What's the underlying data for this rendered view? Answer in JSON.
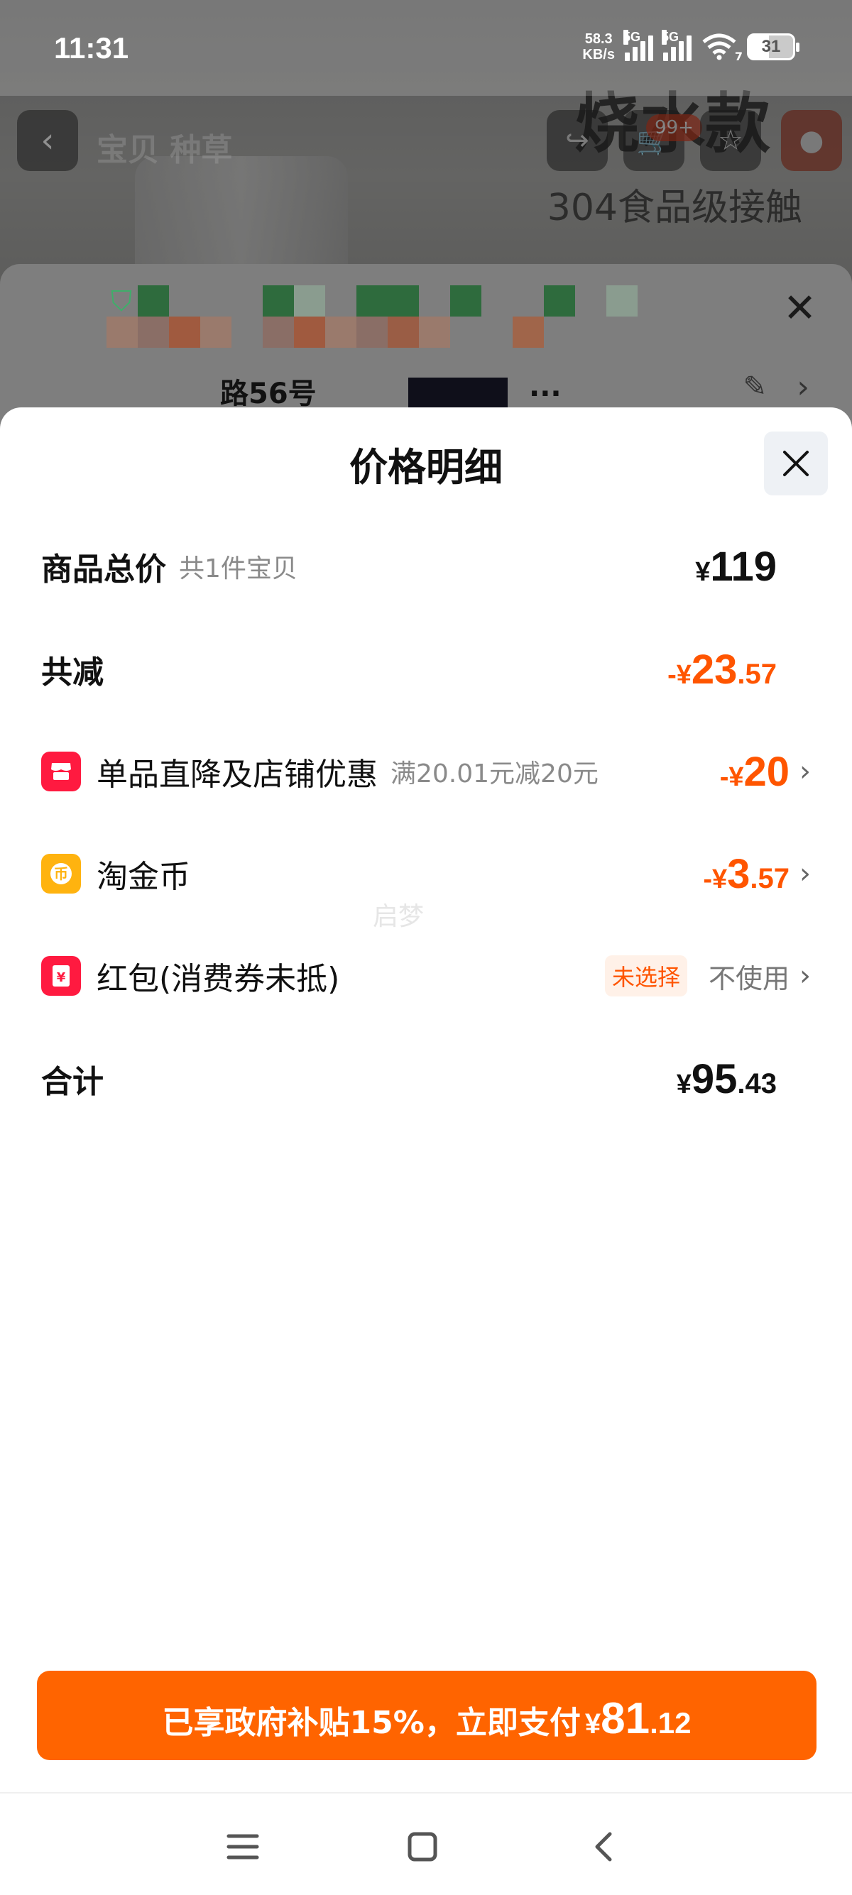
{
  "status_bar": {
    "time": "11:31",
    "net_speed_value": "58.3",
    "net_speed_unit": "KB/s",
    "signal_1_tag": "5G",
    "signal_2_tag": "5G",
    "wifi_tag": "7",
    "battery": "31"
  },
  "background_page": {
    "tabs": "宝贝  种草",
    "cart_badge": "99+",
    "promo_title": "烧水款",
    "promo_subtitle": "304食品级接触",
    "address_fragment": "路56号",
    "address_fragment_2": "..."
  },
  "modal": {
    "title": "价格明细",
    "rows": {
      "subtotal": {
        "label": "商品总价",
        "sub": "共1件宝贝",
        "currency": "¥",
        "int": "119",
        "dec": ""
      },
      "total_discount": {
        "label": "共减",
        "prefix": "-",
        "currency": "¥",
        "int": "23",
        "dec": ".57"
      },
      "shop_discount": {
        "label": "单品直降及店铺优惠",
        "sub": "满20.01元减20元",
        "prefix": "-",
        "currency": "¥",
        "int": "20",
        "dec": ""
      },
      "coins": {
        "label": "淘金币",
        "prefix": "-",
        "currency": "¥",
        "int": "3",
        "dec": ".57"
      },
      "red_packet": {
        "label": "红包(消费券未抵)",
        "tag": "未选择",
        "value": "不使用"
      },
      "total": {
        "label": "合计",
        "currency": "¥",
        "int": "95",
        "dec": ".43"
      }
    },
    "watermark": "启梦"
  },
  "pay_button": {
    "text": "已享政府补贴15%，立即支付",
    "currency": "¥",
    "int": "81",
    "dec": ".12"
  },
  "colors": {
    "accent_orange": "#ff5500",
    "pay_button": "#ff6400",
    "icon_red": "#ff1a40",
    "icon_yellow": "#ffb30f"
  },
  "icons": {
    "shop_discount": "shop-icon",
    "coins": "coin-icon",
    "red_packet": "red-packet-icon"
  }
}
